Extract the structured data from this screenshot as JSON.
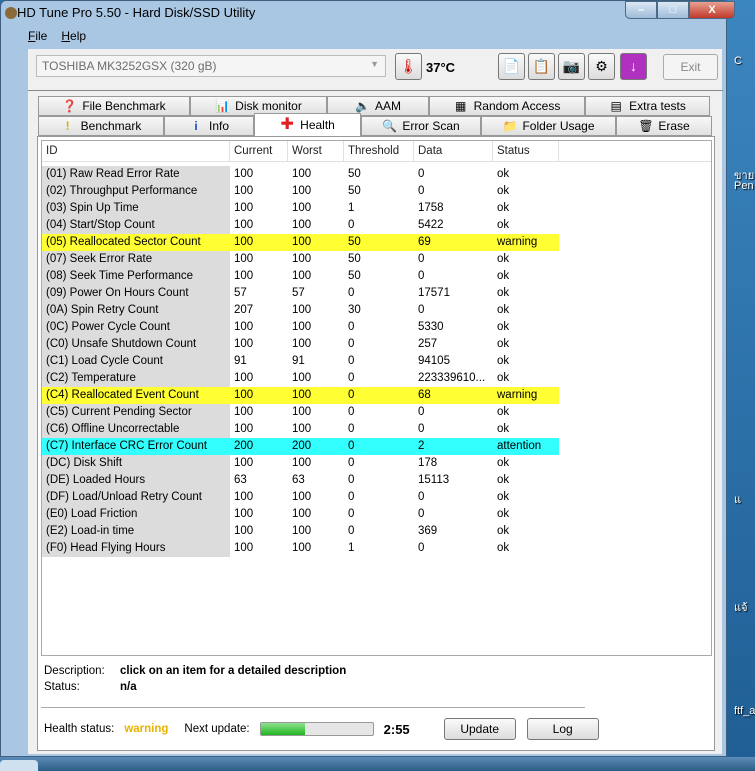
{
  "window": {
    "title": "HD Tune Pro 5.50 - Hard Disk/SSD Utility",
    "min": "–",
    "max": "□",
    "close": "X"
  },
  "menu": [
    {
      "label": "File",
      "key": "F",
      "rest": "ile"
    },
    {
      "label": "Help",
      "key": "H",
      "rest": "elp"
    }
  ],
  "toolbar": {
    "drive": "TOSHIBA MK3252GSX (320 gB)",
    "temperature": "37°C",
    "exit": "Exit"
  },
  "tabs_row1": [
    {
      "label": "File Benchmark",
      "icon": "file-benchmark-icon",
      "glyph": "❓"
    },
    {
      "label": "Disk monitor",
      "icon": "disk-monitor-icon",
      "glyph": "📊"
    },
    {
      "label": "AAM",
      "icon": "speaker-icon",
      "glyph": "🔈"
    },
    {
      "label": "Random Access",
      "icon": "random-access-icon",
      "glyph": "▦"
    },
    {
      "label": "Extra tests",
      "icon": "extra-tests-icon",
      "glyph": "▤"
    }
  ],
  "tabs_row2": [
    {
      "label": "Benchmark",
      "icon": "exclamation-icon",
      "glyph": "!"
    },
    {
      "label": "Info",
      "icon": "info-icon",
      "glyph": "i"
    },
    {
      "label": "Health",
      "icon": "health-cross-icon",
      "glyph": "✚"
    },
    {
      "label": "Error Scan",
      "icon": "magnifier-icon",
      "glyph": "🔍"
    },
    {
      "label": "Folder Usage",
      "icon": "folder-icon",
      "glyph": "📁"
    },
    {
      "label": "Erase",
      "icon": "trash-icon",
      "glyph": "🗑"
    }
  ],
  "columns": [
    "ID",
    "Current",
    "Worst",
    "Threshold",
    "Data",
    "Status"
  ],
  "rows": [
    [
      "(01) Raw Read Error Rate",
      "100",
      "100",
      "50",
      "0",
      "ok"
    ],
    [
      "(02) Throughput Performance",
      "100",
      "100",
      "50",
      "0",
      "ok"
    ],
    [
      "(03) Spin Up Time",
      "100",
      "100",
      "1",
      "1758",
      "ok"
    ],
    [
      "(04) Start/Stop Count",
      "100",
      "100",
      "0",
      "5422",
      "ok"
    ],
    [
      "(05) Reallocated Sector Count",
      "100",
      "100",
      "50",
      "69",
      "warning"
    ],
    [
      "(07) Seek Error Rate",
      "100",
      "100",
      "50",
      "0",
      "ok"
    ],
    [
      "(08) Seek Time Performance",
      "100",
      "100",
      "50",
      "0",
      "ok"
    ],
    [
      "(09) Power On Hours Count",
      "57",
      "57",
      "0",
      "17571",
      "ok"
    ],
    [
      "(0A) Spin Retry Count",
      "207",
      "100",
      "30",
      "0",
      "ok"
    ],
    [
      "(0C) Power Cycle Count",
      "100",
      "100",
      "0",
      "5330",
      "ok"
    ],
    [
      "(C0) Unsafe Shutdown Count",
      "100",
      "100",
      "0",
      "257",
      "ok"
    ],
    [
      "(C1) Load Cycle Count",
      "91",
      "91",
      "0",
      "94105",
      "ok"
    ],
    [
      "(C2) Temperature",
      "100",
      "100",
      "0",
      "223339610...",
      "ok"
    ],
    [
      "(C4) Reallocated Event Count",
      "100",
      "100",
      "0",
      "68",
      "warning"
    ],
    [
      "(C5) Current Pending Sector",
      "100",
      "100",
      "0",
      "0",
      "ok"
    ],
    [
      "(C6) Offline Uncorrectable",
      "100",
      "100",
      "0",
      "0",
      "ok"
    ],
    [
      "(C7) Interface CRC Error Count",
      "200",
      "200",
      "0",
      "2",
      "attention"
    ],
    [
      "(DC) Disk Shift",
      "100",
      "100",
      "0",
      "178",
      "ok"
    ],
    [
      "(DE) Loaded Hours",
      "63",
      "63",
      "0",
      "15113",
      "ok"
    ],
    [
      "(DF) Load/Unload Retry Count",
      "100",
      "100",
      "0",
      "0",
      "ok"
    ],
    [
      "(E0) Load Friction",
      "100",
      "100",
      "0",
      "0",
      "ok"
    ],
    [
      "(E2) Load-in time",
      "100",
      "100",
      "0",
      "369",
      "ok"
    ],
    [
      "(F0) Head Flying Hours",
      "100",
      "100",
      "1",
      "0",
      "ok"
    ]
  ],
  "info": {
    "description_label": "Description:",
    "description": "click on an item for a detailed description",
    "status_label": "Status:",
    "status": "n/a"
  },
  "bottom": {
    "health_label": "Health status:",
    "health": "warning",
    "next_label": "Next update:",
    "progress_percent": 40,
    "countdown": "2:55",
    "update": "Update",
    "log": "Log"
  },
  "desktop": [
    "C",
    "ขาย",
    "Pen",
    "แ",
    "แจ้",
    "ftf_a"
  ],
  "colors": {
    "warning": "#ffff33",
    "attention": "#33ffff",
    "health_warning": "#e8b400"
  }
}
